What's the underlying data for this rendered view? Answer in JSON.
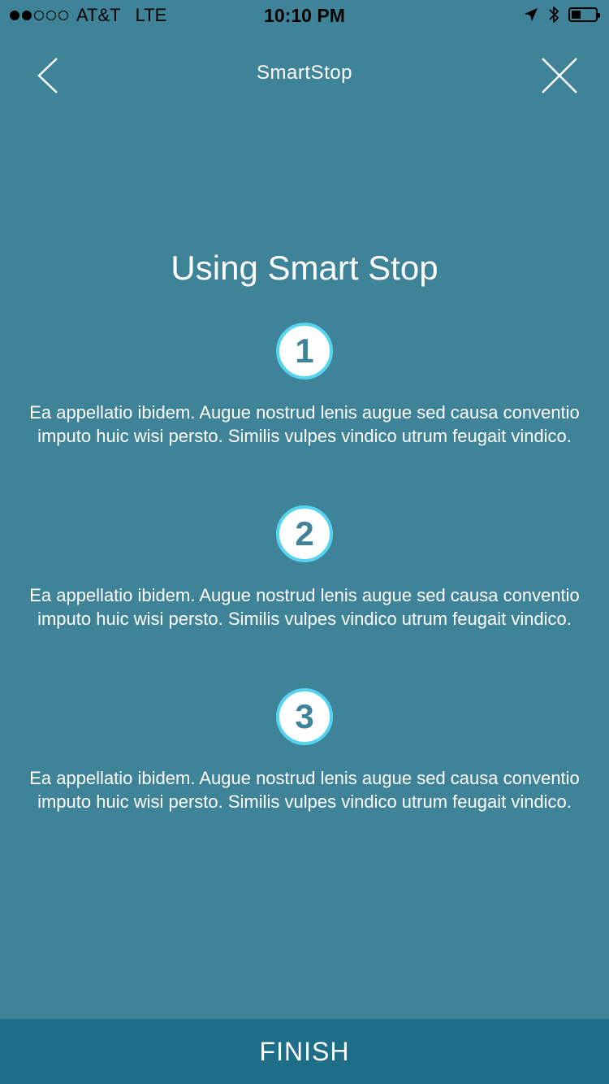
{
  "status_bar": {
    "carrier": "AT&T",
    "network": "LTE",
    "time": "10:10 PM",
    "signal_bars_filled": 2,
    "signal_bars_total": 5,
    "battery_level": 0.4,
    "icons": [
      "location-arrow-icon",
      "bluetooth-icon",
      "battery-icon"
    ]
  },
  "nav": {
    "title": "SmartStop",
    "back_icon": "chevron-left-icon",
    "close_icon": "close-icon"
  },
  "heading": "Using Smart Stop",
  "steps": [
    {
      "number": "1",
      "text": "Ea appellatio ibidem. Augue nostrud lenis augue sed causa conventio imputo huic wisi persto. Similis vulpes vindico utrum feugait vindico."
    },
    {
      "number": "2",
      "text": "Ea appellatio ibidem. Augue nostrud lenis augue sed causa conventio imputo huic wisi persto. Similis vulpes vindico utrum feugait vindico."
    },
    {
      "number": "3",
      "text": "Ea appellatio ibidem. Augue nostrud lenis augue sed causa conventio imputo huic wisi persto. Similis vulpes vindico utrum feugait vindico."
    }
  ],
  "finish_label": "FINISH",
  "colors": {
    "background": "#3f8399",
    "finish_bar": "#1f6e89",
    "step_ring": "#56d3ee"
  }
}
